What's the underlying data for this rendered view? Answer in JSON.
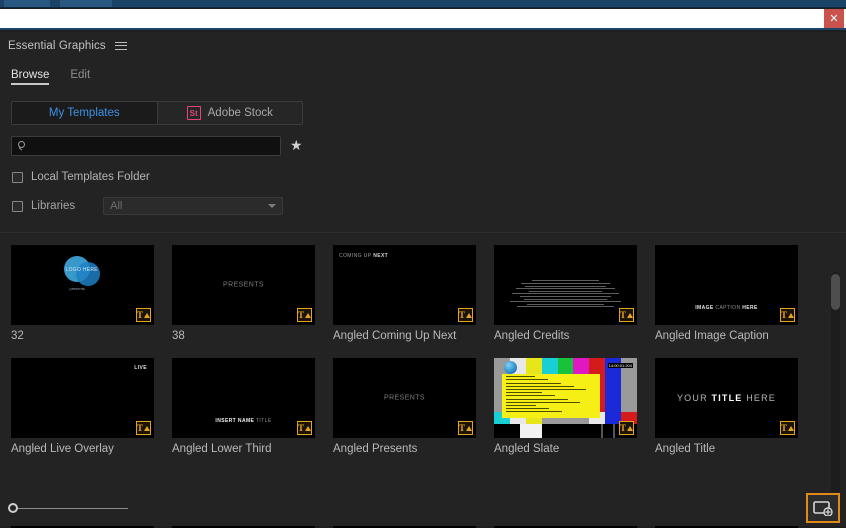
{
  "window": {
    "close_label": "✕"
  },
  "panel": {
    "title": "Essential Graphics",
    "menu_icon": "hamburger-menu-icon"
  },
  "tabs": [
    {
      "label": "Browse",
      "active": true
    },
    {
      "label": "Edit",
      "active": false
    }
  ],
  "source_toggle": [
    {
      "label": "My Templates",
      "active": true
    },
    {
      "label": "Adobe Stock",
      "active": false,
      "badge": "St"
    }
  ],
  "search": {
    "value": "",
    "placeholder": "",
    "icon": "search-icon",
    "favorite_icon": "★"
  },
  "filters": {
    "local_templates": {
      "label": "Local Templates Folder",
      "checked": false
    },
    "libraries": {
      "label": "Libraries",
      "checked": false,
      "selected": "All"
    }
  },
  "templates": [
    {
      "name": "32",
      "art": "logo",
      "badge": "T"
    },
    {
      "name": "38",
      "art": "presents",
      "caption": "PRESENTS",
      "badge": "T"
    },
    {
      "name": "Angled Coming Up Next",
      "art": "comingup",
      "caption": "COMING UP NEXT",
      "badge": "T"
    },
    {
      "name": "Angled Credits",
      "art": "credits",
      "badge": "T"
    },
    {
      "name": "Angled Image Caption",
      "art": "caption",
      "caption": "IMAGE CAPTION HERE",
      "badge": "T"
    },
    {
      "name": "Angled Live Overlay",
      "art": "live",
      "caption": "LIVE",
      "badge": "T"
    },
    {
      "name": "Angled Lower Third",
      "art": "lower",
      "caption": "INSERT NAME TITLE",
      "badge": "T"
    },
    {
      "name": "Angled Presents",
      "art": "presents",
      "caption": "PRESENTS",
      "badge": "T"
    },
    {
      "name": "Angled Slate",
      "art": "slate",
      "badge": "T",
      "timecode": "14:00:01:204"
    },
    {
      "name": "Angled Title",
      "art": "title",
      "caption": "YOUR TITLE HERE",
      "badge": "T"
    }
  ],
  "colors": {
    "accent_blue": "#3d91e6",
    "stock_pink": "#e3447b",
    "badge_yellow": "#e8a31e",
    "highlight_orange": "#e08a1e",
    "close_red": "#c8544d",
    "panel_bg": "#232323"
  },
  "footer": {
    "zoom_value": 0,
    "new_layer_icon": "new-layer-icon"
  },
  "scrollbar": {
    "position": 0
  }
}
